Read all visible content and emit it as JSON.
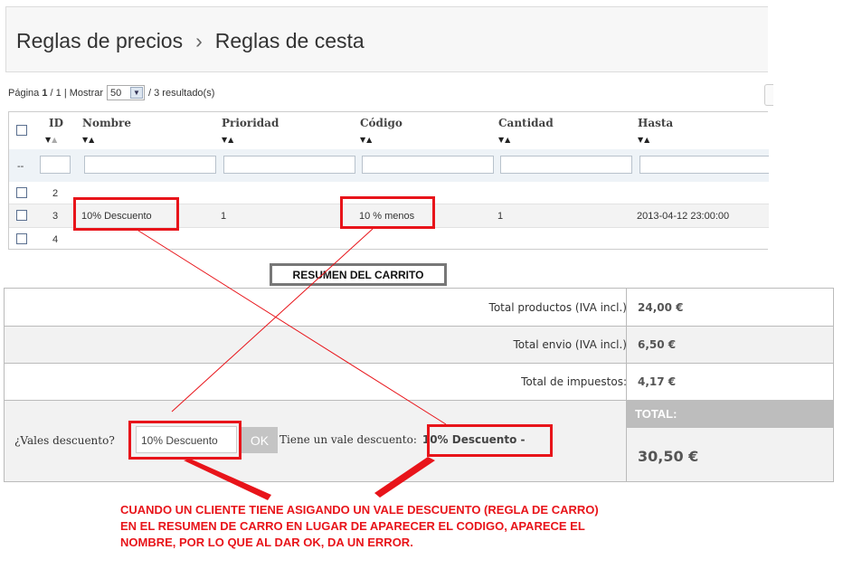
{
  "header": {
    "breadcrumb_parent": "Reglas de precios",
    "separator": "›",
    "breadcrumb_current": "Reglas de cesta"
  },
  "pager": {
    "page_label": "Página",
    "current_page": "1",
    "total_pages": "/ 1",
    "show_label": "| Mostrar",
    "per_page": "50",
    "results": "/ 3 resultado(s)"
  },
  "grid": {
    "columns": [
      "ID",
      "Nombre",
      "Prioridad",
      "Código",
      "Cantidad",
      "Hasta"
    ],
    "filter_dash": "--",
    "rows": [
      {
        "id": "2",
        "nombre": "",
        "prioridad": "",
        "codigo": "",
        "cantidad": "",
        "hasta": ""
      },
      {
        "id": "3",
        "nombre": "10% Descuento",
        "prioridad": "1",
        "codigo": "10 % menos",
        "cantidad": "1",
        "hasta": "2013-04-12 23:00:00"
      },
      {
        "id": "4",
        "nombre": "",
        "prioridad": "",
        "codigo": "",
        "cantidad": "",
        "hasta": ""
      }
    ]
  },
  "summary": {
    "title": "RESUMEN DEL CARRITO",
    "rows": [
      {
        "label": "Total productos (IVA incl.)",
        "value": "24,00 €"
      },
      {
        "label": "Total envio (IVA incl.)",
        "value": "6,50 €"
      },
      {
        "label": "Total de impuestos:",
        "value": "4,17 €"
      }
    ],
    "voucher_label": "¿Vales descuento?",
    "voucher_value": "10% Descuento",
    "ok_label": "OK",
    "has_voucher_label": "Tiene un vale descuento:",
    "has_voucher_value": "10% Descuento -",
    "total_label": "TOTAL:",
    "total_value": "30,50 €"
  },
  "annotation": {
    "lines": [
      "CUANDO UN CLIENTE TIENE ASIGANDO UN VALE DESCUENTO (REGLA DE CARRO)",
      "EN EL RESUMEN DE CARRO EN LUGAR DE APARECER EL CODIGO, APARECE EL",
      "NOMBRE, POR LO QUE AL DAR OK, DA UN ERROR."
    ],
    "color": "#e8141a"
  }
}
